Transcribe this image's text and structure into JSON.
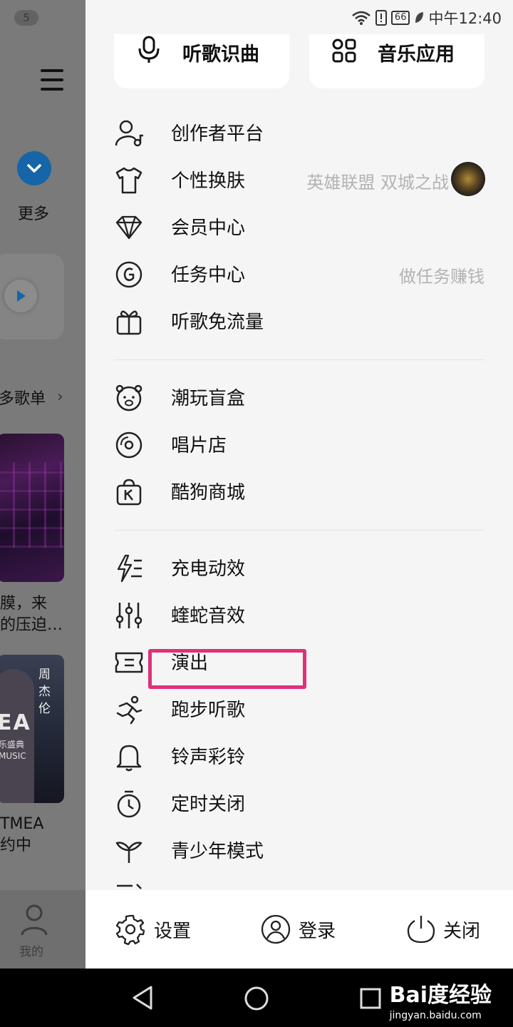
{
  "status_bar": {
    "battery": "66",
    "time": "中午12:40"
  },
  "background_app": {
    "badge": "5",
    "more_label": "更多",
    "playlist_link": "多歌单",
    "cover1_caption_line1": "膜，来",
    "cover1_caption_line2": "的压迫…",
    "cover2_overlay_name": "周杰伦",
    "cover2_overlay_big": "EA",
    "cover2_overlay_small1": "乐盛典",
    "cover2_overlay_small2": "MUSIC",
    "cover2_caption_line1": "TMEA",
    "cover2_caption_line2": "约中",
    "tab_mine": "我的"
  },
  "drawer": {
    "top_cards": [
      {
        "label": "听歌识曲",
        "icon": "mic-icon"
      },
      {
        "label": "音乐应用",
        "icon": "apps-grid-icon"
      }
    ],
    "section1": [
      {
        "label": "创作者平台",
        "icon": "creator-icon"
      },
      {
        "label": "个性换肤",
        "icon": "tshirt-icon",
        "sub": "英雄联盟 双城之战"
      },
      {
        "label": "会员中心",
        "icon": "diamond-icon"
      },
      {
        "label": "任务中心",
        "icon": "coin-icon",
        "sub": "做任务赚钱"
      },
      {
        "label": "听歌免流量",
        "icon": "gift-icon"
      }
    ],
    "section2": [
      {
        "label": "潮玩盲盒",
        "icon": "bear-icon"
      },
      {
        "label": "唱片店",
        "icon": "vinyl-icon"
      },
      {
        "label": "酷狗商城",
        "icon": "shop-bag-icon"
      }
    ],
    "section3": [
      {
        "label": "充电动效",
        "icon": "charge-icon"
      },
      {
        "label": "蝰蛇音效",
        "icon": "equalizer-icon"
      },
      {
        "label": "演出",
        "icon": "ticket-icon"
      },
      {
        "label": "跑步听歌",
        "icon": "running-icon"
      },
      {
        "label": "铃声彩铃",
        "icon": "bell-icon"
      },
      {
        "label": "定时关闭",
        "icon": "timer-icon"
      },
      {
        "label": "青少年模式",
        "icon": "sprout-icon"
      }
    ],
    "bottom": {
      "settings": "设置",
      "login": "登录",
      "close": "关闭"
    },
    "highlight_color": "#e0307a"
  },
  "watermark": {
    "line1": "Bai度经验",
    "line2": "jingyan.baidu.com"
  }
}
